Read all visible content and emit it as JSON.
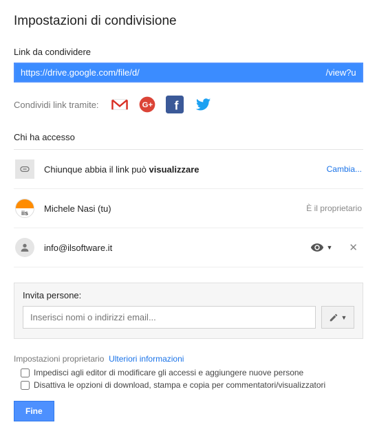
{
  "title": "Impostazioni di condivisione",
  "link_section_label": "Link da condividere",
  "link_value": "https://drive.google.com/file/d/                                                                           /view?usp=sh",
  "share_via_label": "Condividi link tramite:",
  "share_icons": {
    "gmail": "gmail-icon",
    "gplus": "google-plus-icon",
    "facebook": "facebook-icon",
    "twitter": "twitter-icon"
  },
  "access_title": "Chi ha accesso",
  "access": [
    {
      "text_prefix": "Chiunque abbia il link può ",
      "text_bold": "visualizzare",
      "action": "Cambia..."
    },
    {
      "name": "Michele Nasi (tu)",
      "role": "È il proprietario"
    },
    {
      "email": "info@ilsoftware.it"
    }
  ],
  "invite": {
    "label": "Invita persone:",
    "placeholder": "Inserisci nomi o indirizzi email..."
  },
  "owner_settings": {
    "heading": "Impostazioni proprietario",
    "more": "Ulteriori informazioni",
    "opt1": "Impedisci agli editor di modificare gli accessi e aggiungere nuove persone",
    "opt2": "Disattiva le opzioni di download, stampa e copia per commentatori/visualizzatori"
  },
  "done": "Fine"
}
